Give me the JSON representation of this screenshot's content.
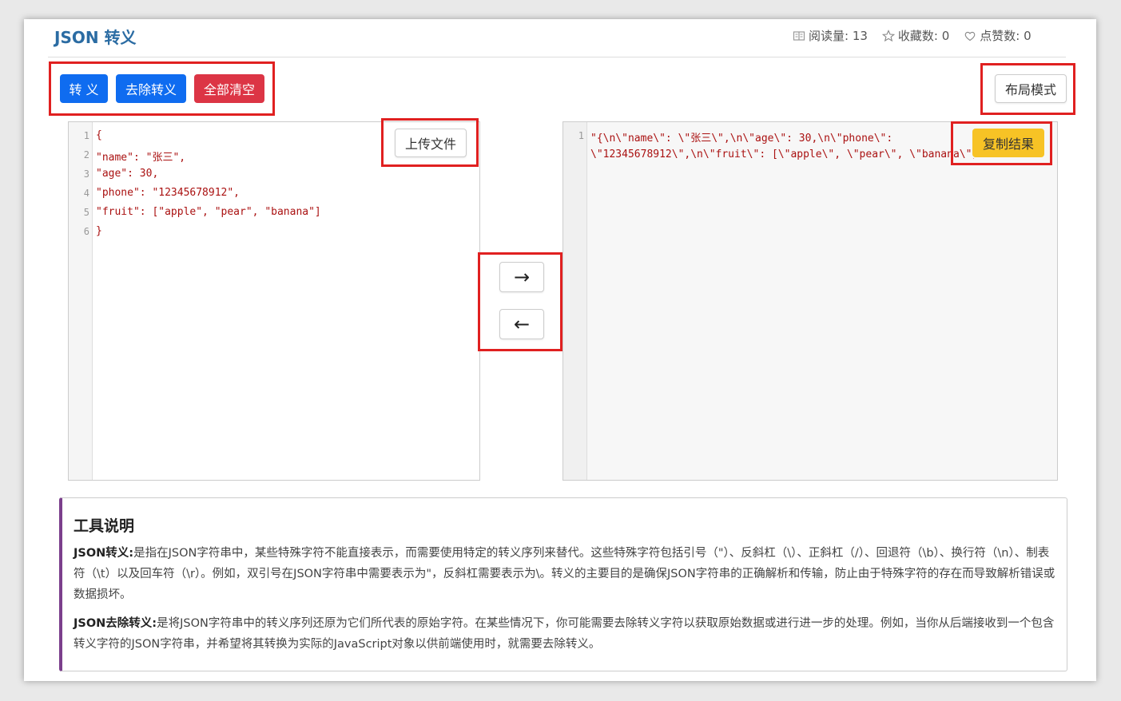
{
  "header": {
    "title": "JSON 转义",
    "reads_label": "阅读量: 13",
    "favorites_label": "收藏数: 0",
    "likes_label": "点赞数: 0"
  },
  "toolbar": {
    "escape_label": "转 义",
    "unescape_label": "去除转义",
    "clear_label": "全部清空",
    "layout_label": "布局模式"
  },
  "input_editor": {
    "upload_label": "上传文件",
    "lines": [
      {
        "n": "1",
        "text": "{"
      },
      {
        "n": "2",
        "text": "\"name\": \"张三\","
      },
      {
        "n": "3",
        "text": "\"age\": 30,"
      },
      {
        "n": "4",
        "text": "\"phone\": \"12345678912\","
      },
      {
        "n": "5",
        "text": "\"fruit\": [\"apple\", \"pear\", \"banana\"]"
      },
      {
        "n": "6",
        "text": "}"
      }
    ]
  },
  "arrows": {
    "right": "→",
    "left": "←"
  },
  "output_editor": {
    "copy_label": "复制结果",
    "line_number": "1",
    "line1": "\"{\\n\\\"name\\\": \\\"张三\\\",\\n\\\"age\\\": 30,\\n\\\"phone\\\":",
    "line2": "\\\"12345678912\\\",\\n\\\"fruit\\\": [\\\"apple\\\", \\\"pear\\\", \\\"banana\\\"]\\n}\""
  },
  "description": {
    "title": "工具说明",
    "escape_term": "JSON转义:",
    "escape_text": "是指在JSON字符串中，某些特殊字符不能直接表示，而需要使用特定的转义序列来替代。这些特殊字符包括引号（\"）、反斜杠（\\）、正斜杠（/）、回退符（\\b）、换行符（\\n）、制表符（\\t）以及回车符（\\r）。例如，双引号在JSON字符串中需要表示为\"，反斜杠需要表示为\\。转义的主要目的是确保JSON字符串的正确解析和传输，防止由于特殊字符的存在而导致解析错误或数据损坏。",
    "unescape_term": "JSON去除转义:",
    "unescape_text": "是将JSON字符串中的转义序列还原为它们所代表的原始字符。在某些情况下，你可能需要去除转义字符以获取原始数据或进行进一步的处理。例如，当你从后端接收到一个包含转义字符的JSON字符串，并希望将其转换为实际的JavaScript对象以供前端使用时，就需要去除转义。"
  },
  "colors": {
    "primary": "#0f6cf0",
    "danger": "#dc3545",
    "warning": "#f7c325",
    "highlight_border": "#e02020",
    "title": "#2b6ca3",
    "description_accent": "#7b3f8c"
  }
}
